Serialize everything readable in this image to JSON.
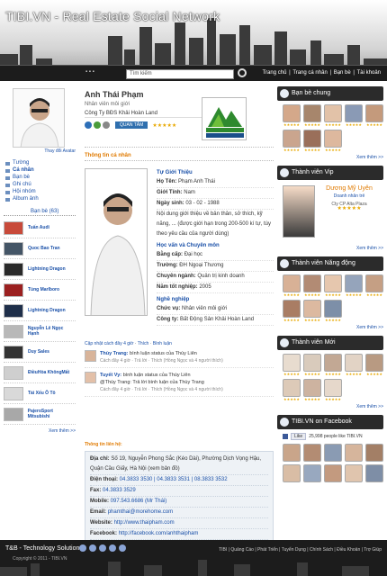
{
  "header": {
    "brand": "TIBI.VN - Real Estate Social Network",
    "search_placeholder": "Tìm kiếm",
    "nav": [
      "Trang chủ",
      "Trang cá nhân",
      "Bạn bè",
      "Tài khoản"
    ]
  },
  "left": {
    "change_avatar": "Thay đổi Avatar",
    "menu": [
      "Tường",
      "Cá nhân",
      "Bạn bè",
      "Ghi chú",
      "Hội nhóm",
      "Album ảnh"
    ],
    "friends_title": "Bạn bè (63)",
    "friends": [
      "Tuấn Audi",
      "Quoc Bao Tran",
      "Lightning Dragon",
      "Tùng Marlboro",
      "Lightning Dragon",
      "Nguyễn Lê Ngọc Hạnh",
      "Duy Sales",
      "ĐiềuHòa KhôngMất",
      "Tài Xếu Ô Tô",
      "PajeroSport Mitsubishi"
    ],
    "more": "Xem thêm >>"
  },
  "profile": {
    "name": "Anh Thái Phạm",
    "title": "Nhân viên môi giới",
    "company": "Công Ty BĐS Khải Hoàn Land",
    "follow": "QUAN TÂM",
    "logo_name": "KHẢI HOÀN LAND",
    "logo_iso": "ISO 9001:2008"
  },
  "info": {
    "section": "Thông tin cá nhân",
    "about_title": "Tự Giới Thiệu",
    "rows1": [
      [
        "Họ Tên:",
        "Phạm Anh Thái"
      ],
      [
        "Giới Tính:",
        "Nam"
      ],
      [
        "Ngày sinh:",
        "03 - 02 - 1988"
      ]
    ],
    "bio": "Nội dung giới thiệu về bản thân, sở thích, kỹ năng, ... (được giới hạn trong 200-500 kí tự, tùy theo yêu cầu của người dùng)",
    "edu_title": "Học vấn và Chuyên môn",
    "rows2": [
      [
        "Bằng cấp:",
        "Đại học"
      ],
      [
        "Trường:",
        "ĐH Ngoại Thương"
      ],
      [
        "Chuyên ngành:",
        "Quản trị kinh doanh"
      ],
      [
        "Năm tốt nghiệp:",
        "2005"
      ]
    ],
    "job_title": "Nghề nghiệp",
    "rows3": [
      [
        "Chức vụ:",
        "Nhân viên môi giới"
      ],
      [
        "Công ty:",
        "Bất Động Sản Khải Hoàn Land"
      ]
    ]
  },
  "activity": {
    "line": "Cập nhật cách đây 4 giờ",
    "thich": "Thích",
    "binh_luan": "Bình luận",
    "items": [
      {
        "name": "Thùy Trang:",
        "text": "bình luận status của Thùy Liên",
        "meta": "Cách đây 4 giờ · Trả lời · Thích (Hồng Ngọc và 4 người thích)"
      },
      {
        "name": "Tuyết Vy:",
        "text": "bình luận status của Thùy Liên",
        "text2": "@Thùy Trang: Trả lời bình luận của Thùy Trang",
        "meta": "Cách đây 4 giờ · Trả lời · Thích (Hồng Ngọc và 4 người thích)"
      }
    ]
  },
  "contact": {
    "title": "Thông tin liên hệ:",
    "rows": [
      [
        "Địa chỉ:",
        "Số 19, Nguyễn Phong Sắc (Kéo Dài), Phường Dịch Vọng Hậu, Quận Cầu Giấy, Hà Nội (xem bản đồ)"
      ],
      [
        "Điện thoại:",
        "04.3833 3530 | 04.3833 3531 | 08.3833 3532"
      ],
      [
        "Fax:",
        "04.3833 3529"
      ],
      [
        "Mobile:",
        "097.543.6686 (Mr Thái)"
      ],
      [
        "Email:",
        "phamthai@morehome.com"
      ],
      [
        "Website:",
        "http://www.thaipham.com"
      ],
      [
        "Facebook:",
        "http://facebook.com/anhthaipham"
      ]
    ]
  },
  "right": {
    "friends_pane": "Bạn bè chung",
    "vip_pane": "Thành viên Vip",
    "vip": {
      "name": "Dương Mỹ Uyên",
      "title": "Doanh nhân trẻ",
      "company": "Cty CP Alta Plaza"
    },
    "active_pane": "Thành viên Năng động",
    "new_pane": "Thành viên Mới",
    "fb_pane": "TIBI.VN on Facebook",
    "fb_like": "Like",
    "fb_text": "25,998 people like TIBI.VN",
    "more": "Xem thêm >>"
  },
  "footer": {
    "company": "T&B - Technology Solution",
    "copy": "Copyright © 2011 - TIBI.VN",
    "links": "TIBI | Quảng Cáo | Phát Triển | Tuyển Dụng | Chính Sách | Điều Khoản | Trợ Giúp"
  }
}
